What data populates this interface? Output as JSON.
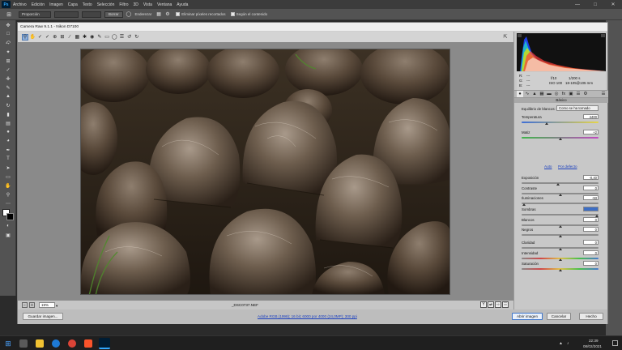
{
  "ps": {
    "logo": "Ps",
    "menu": [
      "Archivo",
      "Edición",
      "Imagen",
      "Capa",
      "Texto",
      "Selección",
      "Filtro",
      "3D",
      "Vista",
      "Ventana",
      "Ayuda"
    ],
    "options": {
      "ratio": "Proporción",
      "clear": "Borrar",
      "straighten": "Enderezar",
      "delete_cropped": "Eliminar píxeles recortados",
      "content_aware": "Según el contenido"
    }
  },
  "camera_raw": {
    "title": "Camera Raw 9.1.1 - Nikon D7100",
    "zoom": "19%",
    "filename": "_DSC0737.NEF",
    "workflow_link": "Adobe RGB (1998); 16 bit; 6000 por 4000 (24,0MP); 300 ppi",
    "buttons": {
      "save": "Guardar imagen...",
      "open": "Abrir imagen",
      "cancel": "Cancelar",
      "done": "Hecho"
    },
    "info": {
      "r": "R:",
      "g": "G:",
      "b": "B:",
      "dash": "---",
      "aperture": "f/10",
      "shutter": "1/200 s",
      "iso": "ISO 100",
      "lens": "18-105@105 mm"
    },
    "panel_title": "Básico",
    "wb_label": "Equilibrio de blancos:",
    "wb_value": "Como se ha tomado",
    "auto": "Auto",
    "defaults": "Por defecto",
    "sliders": [
      {
        "key": "temp",
        "label": "Temperatura",
        "value": "4400",
        "pos": 0.33
      },
      {
        "key": "tint",
        "label": "Matiz",
        "value": "+2",
        "pos": 0.51
      },
      {
        "key": "exp",
        "label": "Exposición",
        "value": "-0,40",
        "pos": 0.47
      },
      {
        "key": "con",
        "label": "Contraste",
        "value": "0",
        "pos": 0.5
      },
      {
        "key": "hl",
        "label": "Iluminaciones",
        "value": "-93",
        "pos": 0.03
      },
      {
        "key": "sh",
        "label": "Sombras",
        "value": "",
        "pos": 0.98
      },
      {
        "key": "wh",
        "label": "Blancos",
        "value": "0",
        "pos": 0.5
      },
      {
        "key": "bl",
        "label": "Negros",
        "value": "0",
        "pos": 0.5
      },
      {
        "key": "cla",
        "label": "Claridad",
        "value": "0",
        "pos": 0.5
      },
      {
        "key": "vib",
        "label": "Intensidad",
        "value": "0",
        "pos": 0.5
      },
      {
        "key": "sat",
        "label": "Saturación",
        "value": "0",
        "pos": 0.5
      }
    ]
  },
  "taskbar": {
    "time": "22:39",
    "date": "08/02/2021"
  },
  "colors": {
    "accent": "#3d6ec4",
    "ps_blue": "#31a8ff"
  }
}
